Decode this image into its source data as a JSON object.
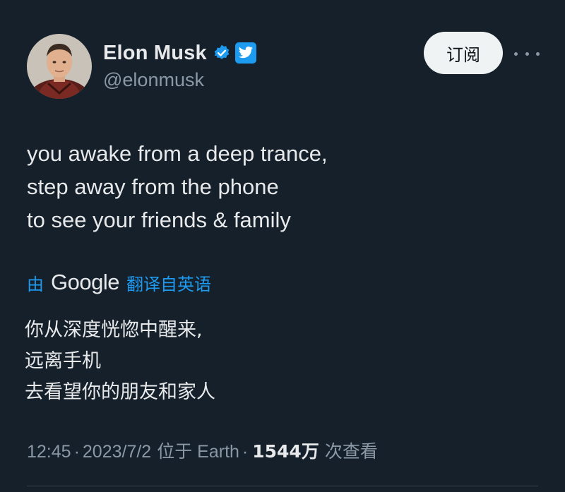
{
  "author": {
    "display_name": "Elon Musk",
    "handle": "@elonmusk",
    "verified_icon": "verified-badge-icon",
    "badge_icon": "twitter-bird-icon"
  },
  "actions": {
    "subscribe_label": "订阅",
    "more_icon": "more-icon"
  },
  "tweet": {
    "lines": [
      "you awake from a deep trance,",
      "step away from the phone",
      "to see your friends & family"
    ]
  },
  "translation": {
    "by_label": "由",
    "provider": "Google",
    "link_label": "翻译自英语",
    "lines": [
      "你从深度恍惚中醒来,",
      "远离手机",
      "去看望你的朋友和家人"
    ]
  },
  "meta": {
    "time": "12:45",
    "separator": "·",
    "date": "2023/7/2",
    "location": "位于 Earth",
    "views_count": "1544万",
    "views_label": "次查看"
  },
  "colors": {
    "background": "#15202b",
    "accent": "#1d9bf0",
    "text": "#e7e9ea",
    "secondary_text": "#8b98a5"
  }
}
